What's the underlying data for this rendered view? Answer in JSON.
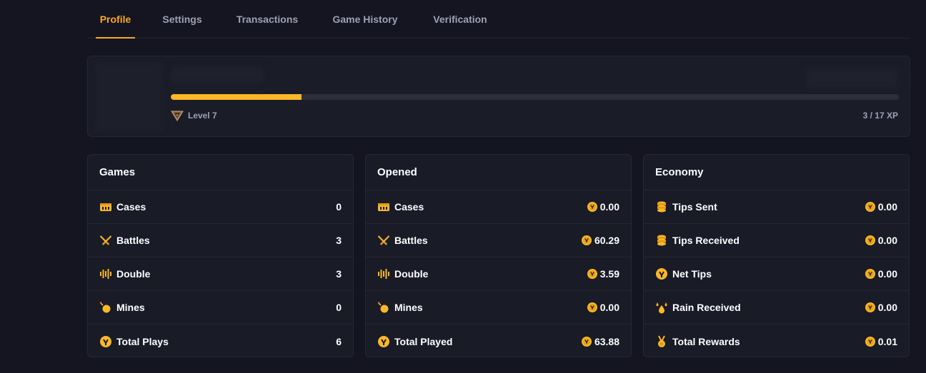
{
  "tabs": [
    {
      "label": "Profile",
      "active": true
    },
    {
      "label": "Settings",
      "active": false
    },
    {
      "label": "Transactions",
      "active": false
    },
    {
      "label": "Game History",
      "active": false
    },
    {
      "label": "Verification",
      "active": false
    }
  ],
  "profile": {
    "level_label": "Level 7",
    "xp_text": "3 / 17 XP",
    "xp_progress": 0.18
  },
  "colors": {
    "accent": "#f9a825",
    "background": "#141520",
    "card": "#191b27"
  },
  "cards": {
    "games": {
      "title": "Games",
      "rows": [
        {
          "icon": "case-icon",
          "label": "Cases",
          "value": "0"
        },
        {
          "icon": "battles-icon",
          "label": "Battles",
          "value": "3"
        },
        {
          "icon": "double-icon",
          "label": "Double",
          "value": "3"
        },
        {
          "icon": "mines-icon",
          "label": "Mines",
          "value": "0"
        },
        {
          "icon": "total-icon",
          "label": "Total Plays",
          "value": "6"
        }
      ]
    },
    "opened": {
      "title": "Opened",
      "rows": [
        {
          "icon": "case-icon",
          "label": "Cases",
          "value": "0.00"
        },
        {
          "icon": "battles-icon",
          "label": "Battles",
          "value": "60.29"
        },
        {
          "icon": "double-icon",
          "label": "Double",
          "value": "3.59"
        },
        {
          "icon": "mines-icon",
          "label": "Mines",
          "value": "0.00"
        },
        {
          "icon": "total-icon",
          "label": "Total Played",
          "value": "63.88"
        }
      ]
    },
    "economy": {
      "title": "Economy",
      "rows": [
        {
          "icon": "coins-stack-icon",
          "label": "Tips Sent",
          "value": "0.00"
        },
        {
          "icon": "coins-stack-icon",
          "label": "Tips Received",
          "value": "0.00"
        },
        {
          "icon": "total-icon",
          "label": "Net Tips",
          "value": "0.00"
        },
        {
          "icon": "rain-icon",
          "label": "Rain Received",
          "value": "0.00"
        },
        {
          "icon": "medal-icon",
          "label": "Total Rewards",
          "value": "0.01"
        }
      ]
    }
  }
}
